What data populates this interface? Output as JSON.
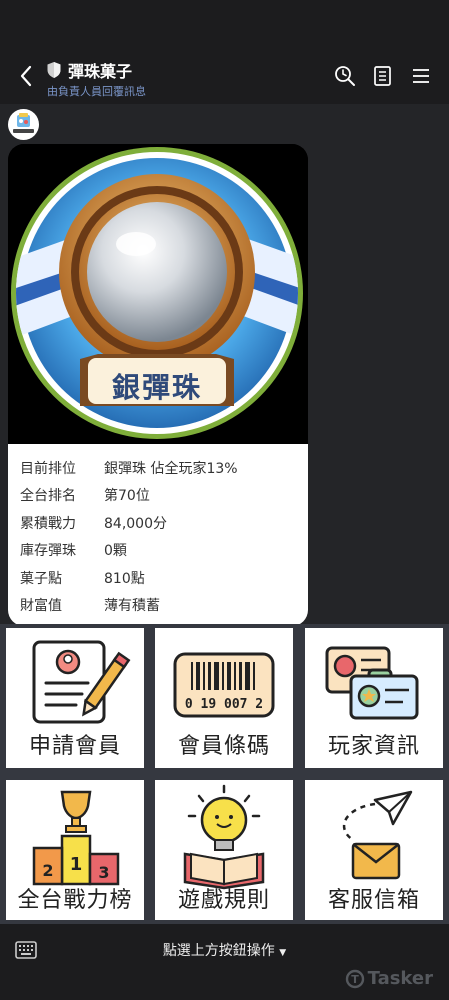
{
  "header": {
    "title": "彈珠菓子",
    "subtitle": "由負責人員回覆訊息"
  },
  "card": {
    "badge_text": "銀彈珠",
    "rows": [
      {
        "label": "目前排位",
        "value": "銀彈珠  佔全玩家13%"
      },
      {
        "label": "全台排名",
        "value": "第70位"
      },
      {
        "label": "累積戰力",
        "value": "84,000分"
      },
      {
        "label": "庫存彈珠",
        "value": "0顆"
      },
      {
        "label": "菓子點",
        "value": "810點"
      },
      {
        "label": "財富值",
        "value": "薄有積蓄"
      }
    ]
  },
  "menu": {
    "tiles": [
      {
        "label": "申請會員",
        "icon": "member-application-icon"
      },
      {
        "label": "會員條碼",
        "icon": "barcode-icon",
        "barcode_number": "0 19 007 2"
      },
      {
        "label": "玩家資訊",
        "icon": "player-info-icon"
      },
      {
        "label": "全台戰力榜",
        "icon": "podium-icon"
      },
      {
        "label": "遊戲規則",
        "icon": "lightbulb-book-icon"
      },
      {
        "label": "客服信箱",
        "icon": "mail-icon"
      }
    ]
  },
  "bottom": {
    "menu_toggle_label": "點選上方按鈕操作",
    "watermark": "Tasker"
  },
  "colors": {
    "accent_blue": "#7a95c8",
    "badge_ring": "#7fae3a",
    "badge_text": "#2f4a7a"
  }
}
